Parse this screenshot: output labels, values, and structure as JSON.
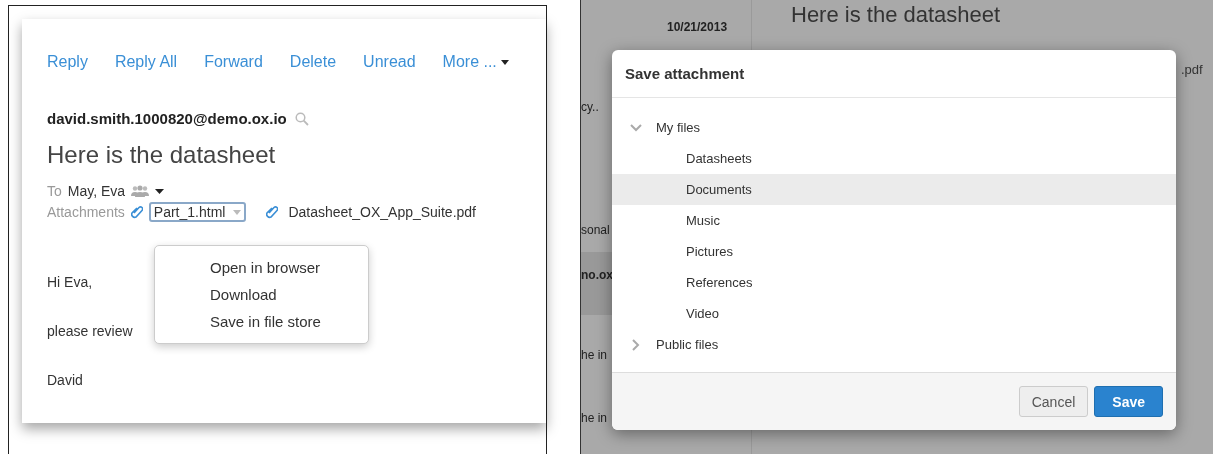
{
  "mail_view": {
    "toolbar": [
      "Reply",
      "Reply All",
      "Forward",
      "Delete",
      "Unread",
      "More ..."
    ],
    "sender": "david.smith.1000820@demo.ox.io",
    "subject": "Here is the datasheet",
    "to_label": "To",
    "to_value": "May, Eva",
    "attachments_label": "Attachments",
    "attachments": [
      {
        "name": "Part_1.html",
        "selected": true
      },
      {
        "name": "Datasheet_OX_App_Suite.pdf",
        "selected": false
      }
    ],
    "body": [
      "Hi Eva,",
      "please review",
      "David"
    ],
    "attachment_menu": [
      "Open in browser",
      "Download",
      "Save in file store"
    ]
  },
  "background": {
    "date": "10/21/2013",
    "subject": "Here is the datasheet",
    "attachment_fragment": ".pdf",
    "list_fragments": [
      "cy..",
      "sonal",
      "no.ox",
      "he in",
      "he in"
    ]
  },
  "dialog": {
    "title": "Save attachment",
    "tree": [
      {
        "label": "My files",
        "expanded": true,
        "selected": false,
        "children": [
          {
            "label": "Datasheets",
            "selected": false
          },
          {
            "label": "Documents",
            "selected": true
          },
          {
            "label": "Music",
            "selected": false
          },
          {
            "label": "Pictures",
            "selected": false
          },
          {
            "label": "References",
            "selected": false
          },
          {
            "label": "Video",
            "selected": false
          }
        ]
      },
      {
        "label": "Public files",
        "expanded": false,
        "selected": false
      }
    ],
    "buttons": [
      {
        "label": "Cancel",
        "kind": "secondary"
      },
      {
        "label": "Save",
        "kind": "primary"
      }
    ]
  }
}
